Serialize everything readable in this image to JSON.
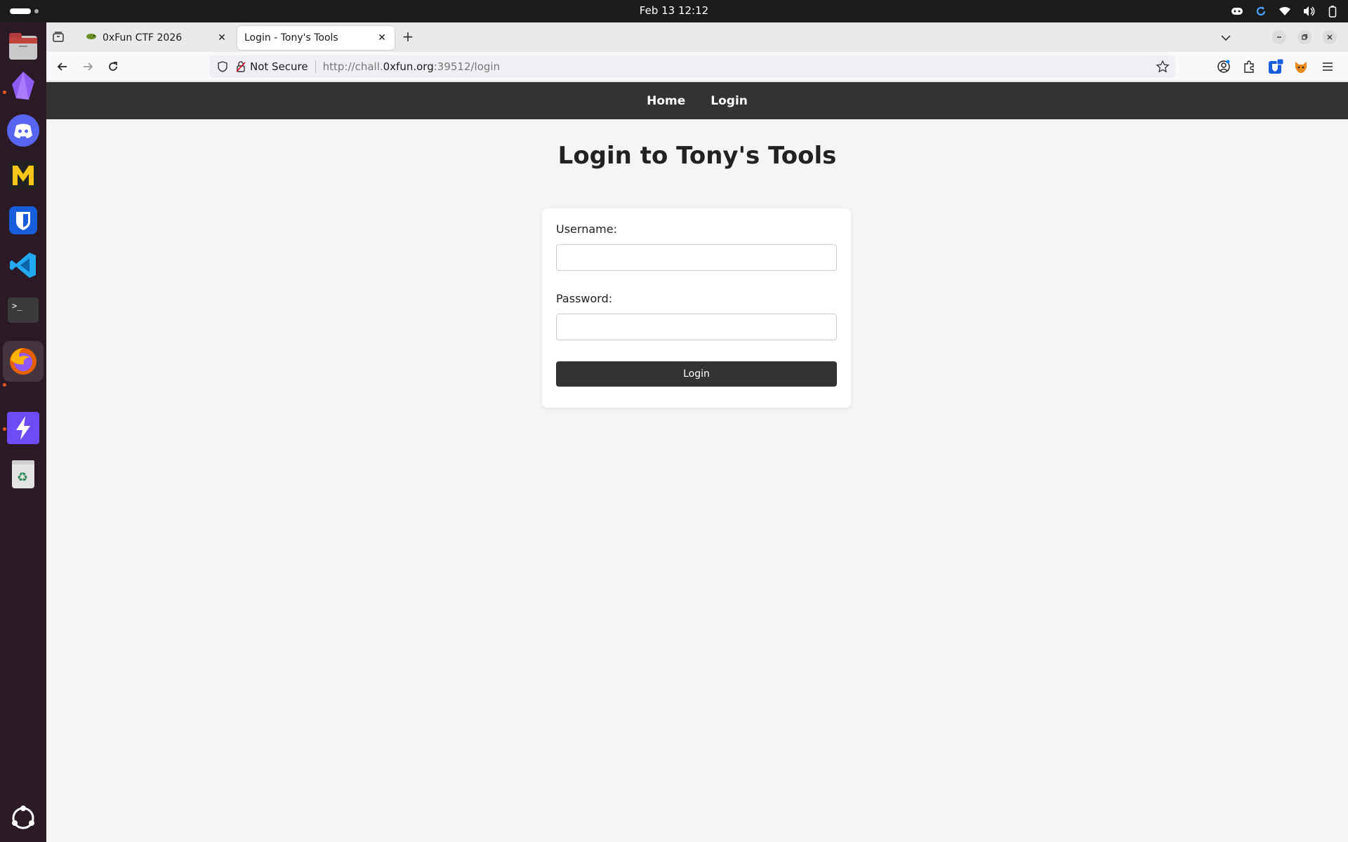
{
  "system": {
    "clock": "Feb 13  12:12"
  },
  "browser": {
    "tabs": [
      {
        "title": "0xFun CTF 2026"
      },
      {
        "title": "Login - Tony's Tools"
      }
    ],
    "url": {
      "security_label": "Not Secure",
      "prefix": "http://chall.",
      "domain": "0xfun.org",
      "suffix": ":39512/login"
    }
  },
  "site": {
    "nav": {
      "home": "Home",
      "login": "Login"
    },
    "heading": "Login to Tony's Tools",
    "form": {
      "username_label": "Username:",
      "username_value": "",
      "password_label": "Password:",
      "password_value": "",
      "submit_label": "Login"
    }
  },
  "colors": {
    "site_nav_bg": "#333333",
    "button_bg": "#333333",
    "page_bg": "#f5f5f5",
    "dock_bg": "#2b1a25"
  }
}
